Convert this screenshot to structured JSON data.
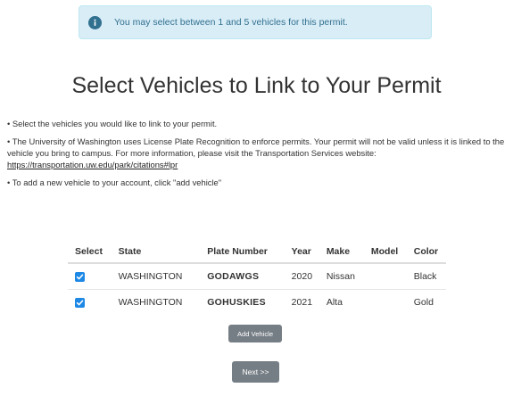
{
  "alert": {
    "icon": "info-icon",
    "text": "You may select between 1 and 5 vehicles for this permit."
  },
  "page": {
    "title": "Select Vehicles to Link to Your Permit"
  },
  "instructions": {
    "line1": "• Select the vehicles you would like to link to your permit.",
    "line2_text": "• The University of Washington uses License Plate Recognition to enforce permits. Your permit will not be valid unless it is linked to the vehicle you bring to campus. For more information, please visit the Transportation Services website: ",
    "line2_link": "https://transportation.uw.edu/park/citations#lpr",
    "line3": "• To add a new vehicle to your account, click \"add vehicle\""
  },
  "table": {
    "headers": [
      "Select",
      "State",
      "Plate Number",
      "Year",
      "Make",
      "Model",
      "Color"
    ],
    "rows": [
      {
        "selected": true,
        "state": "WASHINGTON",
        "plate": "GODAWGS",
        "year": "2020",
        "make": "Nissan",
        "model": "",
        "color": "Black"
      },
      {
        "selected": true,
        "state": "WASHINGTON",
        "plate": "GOHUSKIES",
        "year": "2021",
        "make": "Alta",
        "model": "",
        "color": "Gold"
      }
    ]
  },
  "buttons": {
    "add_vehicle": "Add Vehicle",
    "next": "Next >>"
  },
  "colors": {
    "alert_bg": "#d9edf7",
    "alert_text": "#31708f",
    "checkbox": "#1e88e5",
    "button": "#767e85"
  }
}
